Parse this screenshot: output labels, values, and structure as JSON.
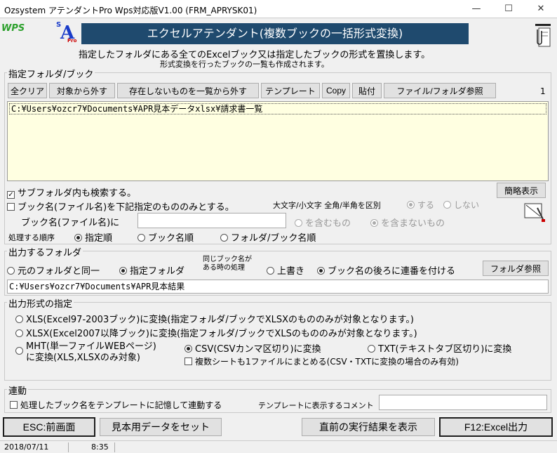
{
  "window": {
    "title": "Ozsystem アテンダントPro Wps対応版V1.00 (FRM_APRYSK01)",
    "minimize": "—",
    "maximize": "☐",
    "close": "✕"
  },
  "logos": {
    "wps": "WPS",
    "sa_s": "S",
    "sa_a": "A",
    "sa_pro": "Pro"
  },
  "header": {
    "banner": "エクセルアテンダント(複数ブックの一括形式変換)",
    "desc1": "指定したフォルダにある全てのExcelブック又は指定したブックの形式を置換します。",
    "desc2": "形式変換を行ったブックの一覧も作成されます。"
  },
  "folder_group": {
    "label": "指定フォルダ/ブック",
    "buttons": {
      "clear_all": "全クリア",
      "exclude": "対象から外す",
      "exclude_missing": "存在しないものを一覧から外す",
      "template": "テンプレート",
      "copy": "Copy",
      "paste": "貼付",
      "browse": "ファイル/フォルダ参照"
    },
    "count": "1",
    "list": [
      "C:¥Users¥ozcr7¥Documents¥APR見本データxlsx¥請求書一覧"
    ],
    "simple_view": "簡略表示",
    "subfolder_label": "サブフォルダ内も検索する。",
    "bookname_only_label": "ブック名(ファイル名)を下記指定のもののみとする。",
    "case_label": "大文字/小文字 全角/半角を区別",
    "case_yes": "する",
    "case_no": "しない",
    "bookname_label": "ブック名(ファイル名)に",
    "bookname_value": "",
    "contains": "を含むもの",
    "not_contains": "を含まないもの",
    "order_label": "処理する順序",
    "order_specified": "指定順",
    "order_bookname": "ブック名順",
    "order_folder": "フォルダ/ブック名順"
  },
  "output_folder": {
    "label": "出力するフォルダ",
    "same": "元のフォルダと同一",
    "specified": "指定フォルダ",
    "same_name1": "同じブック名が",
    "same_name2": "ある時の処理",
    "overwrite": "上書き",
    "append_num": "ブック名の後ろに連番を付ける",
    "browse": "フォルダ参照",
    "path": "C:¥Users¥ozcr7¥Documents¥APR見本結果"
  },
  "format": {
    "label": "出力形式の指定",
    "xls": "XLS(Excel97-2003ブック)に変換(指定フォルダ/ブックでXLSXのもののみが対象となります。)",
    "xlsx": "XLSX(Excel2007以降ブック)に変換(指定フォルダ/ブックでXLSのもののみが対象となります。)",
    "mht1": "MHT(単一ファイルWEBページ)",
    "mht2": "に変換(XLS,XLSXのみ対象)",
    "csv": "CSV(CSVカンマ区切り)に変換",
    "txt": "TXT(テキストタブ区切り)に変換",
    "multi_sheet": "複数シートも1ファイルにまとめる(CSV・TXTに変換の場合のみ有効)"
  },
  "link": {
    "label": "連動",
    "remember": "処理したブック名をテンプレートに記憶して連動する",
    "comment_label": "テンプレートに表示するコメント",
    "comment_value": ""
  },
  "footer": {
    "esc": "ESC:前画面",
    "sample": "見本用データをセット",
    "last_result": "直前の実行結果を表示",
    "f12": "F12:Excel出力"
  },
  "status": {
    "date": "2018/07/11",
    "time": "8:35"
  },
  "colors": {
    "banner_bg": "#1f4a6e",
    "list_bg": "#ffffe1",
    "wps_green": "#2ca02c",
    "logo_blue": "#1a3cc9"
  }
}
